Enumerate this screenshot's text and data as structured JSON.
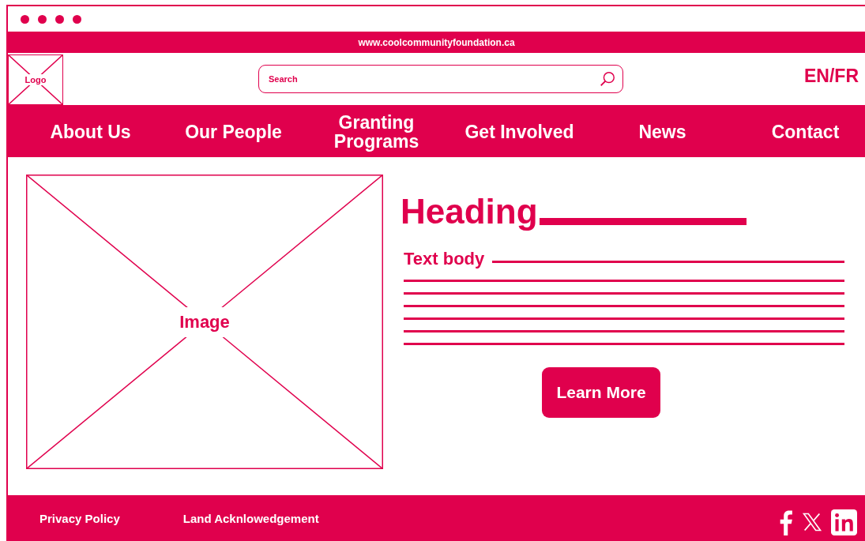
{
  "browser": {
    "url": "www.coolcommunityfoundation.ca"
  },
  "header": {
    "logo": "Logo",
    "search": {
      "placeholder": "Search"
    },
    "language": "EN/FR"
  },
  "nav": [
    {
      "label": "About Us"
    },
    {
      "label": "Our People"
    },
    {
      "label": "Granting Programs"
    },
    {
      "label": "Get Involved"
    },
    {
      "label": "News"
    },
    {
      "label": "Contact"
    }
  ],
  "content": {
    "image_label": "Image",
    "heading": "Heading",
    "body_label": "Text body",
    "button": "Learn More"
  },
  "footer": {
    "links": [
      "Privacy Policy",
      "Land Acknlowedgement"
    ]
  }
}
